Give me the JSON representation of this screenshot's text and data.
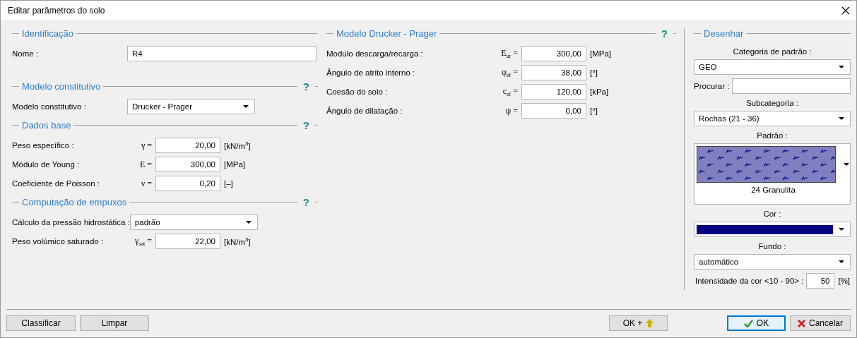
{
  "window": {
    "title": "Editar parâmetros do solo"
  },
  "left_sections": [
    {
      "title": "Identificação",
      "rows": [
        {
          "kind": "text",
          "label": "Nome :",
          "value": "R4"
        }
      ]
    },
    {
      "title": "Modelo constitutivo",
      "help": "?",
      "rows": [
        {
          "kind": "select",
          "label": "Modelo constitutivo :",
          "value": "Drucker - Prager"
        }
      ]
    },
    {
      "title": "Dados base",
      "help": "?",
      "rows": [
        {
          "kind": "number",
          "label": "Peso específico :",
          "symbol": "γ =",
          "value": "20,00",
          "unit": "[kN/m$^{3}$]"
        },
        {
          "kind": "number",
          "label": "Módulo de Young :",
          "symbol": "E =",
          "value": "300,00",
          "unit": "[MPa]"
        },
        {
          "kind": "number",
          "label": "Coeficiente de Poisson :",
          "symbol": "ν =",
          "value": "0,20",
          "unit": "[–]"
        }
      ]
    },
    {
      "title": "Computação de empuxos",
      "help": "?",
      "rows": [
        {
          "kind": "select",
          "label": "Cálculo da pressão hidrostática :",
          "value": "padrão"
        },
        {
          "kind": "number",
          "label": "Peso volúmico saturado :",
          "symbol": "γ$_{sat}$ =",
          "value": "22,00",
          "unit": "[kN/m$^{3}$]"
        }
      ]
    }
  ],
  "middle_sections": [
    {
      "title": "Modelo Drucker - Prager",
      "help": "?",
      "rows": [
        {
          "kind": "number",
          "label": "Modulo descarga/recarga :",
          "symbol": "E$_{ur}$ =",
          "value": "300,00",
          "unit": "[MPa]"
        },
        {
          "kind": "number",
          "label": "Ângulo de atrito interno :",
          "symbol": "φ$_{ef}$ =",
          "value": "38,00",
          "unit": "[°]"
        },
        {
          "kind": "number",
          "label": "Coesão do solo :",
          "symbol": "c$_{ef}$ =",
          "value": "120,00",
          "unit": "[kPa]"
        },
        {
          "kind": "number",
          "label": "Ângulo de dilatação :",
          "symbol": "ψ =",
          "value": "0,00",
          "unit": "[°]"
        }
      ]
    }
  ],
  "draw_panel": {
    "title": "Desenhar",
    "items": [
      {
        "kind": "label",
        "text": "Categoria de padrão :"
      },
      {
        "kind": "select",
        "value": "GEO"
      },
      {
        "kind": "search",
        "label": "Procurar :"
      },
      {
        "kind": "label",
        "text": "Subcategoria :"
      },
      {
        "kind": "select",
        "value": "Rochas (21 - 36)"
      },
      {
        "kind": "label",
        "text": "Padrão :"
      },
      {
        "kind": "pattern",
        "caption": "24 Granulita"
      },
      {
        "kind": "label",
        "text": "Cor :"
      },
      {
        "kind": "color",
        "color": "#000080"
      },
      {
        "kind": "label",
        "text": "Fundo :"
      },
      {
        "kind": "select",
        "value": "automático"
      },
      {
        "kind": "intensity",
        "label": "Intensidade da cor <10 - 90> :",
        "value": "50",
        "unit": "[%]"
      }
    ]
  },
  "left_buttons": [
    {
      "kind": "plain",
      "label": "Classificar",
      "focused": false
    },
    {
      "kind": "plain",
      "label": "Limpar",
      "focused": false
    }
  ],
  "center_buttons": [
    {
      "kind": "ok_plus",
      "label": "OK +",
      "focused": false
    }
  ],
  "right_buttons": [
    {
      "kind": "ok",
      "label": "OK",
      "focused": true
    },
    {
      "kind": "cancel",
      "label": "Cancelar",
      "focused": false
    }
  ]
}
